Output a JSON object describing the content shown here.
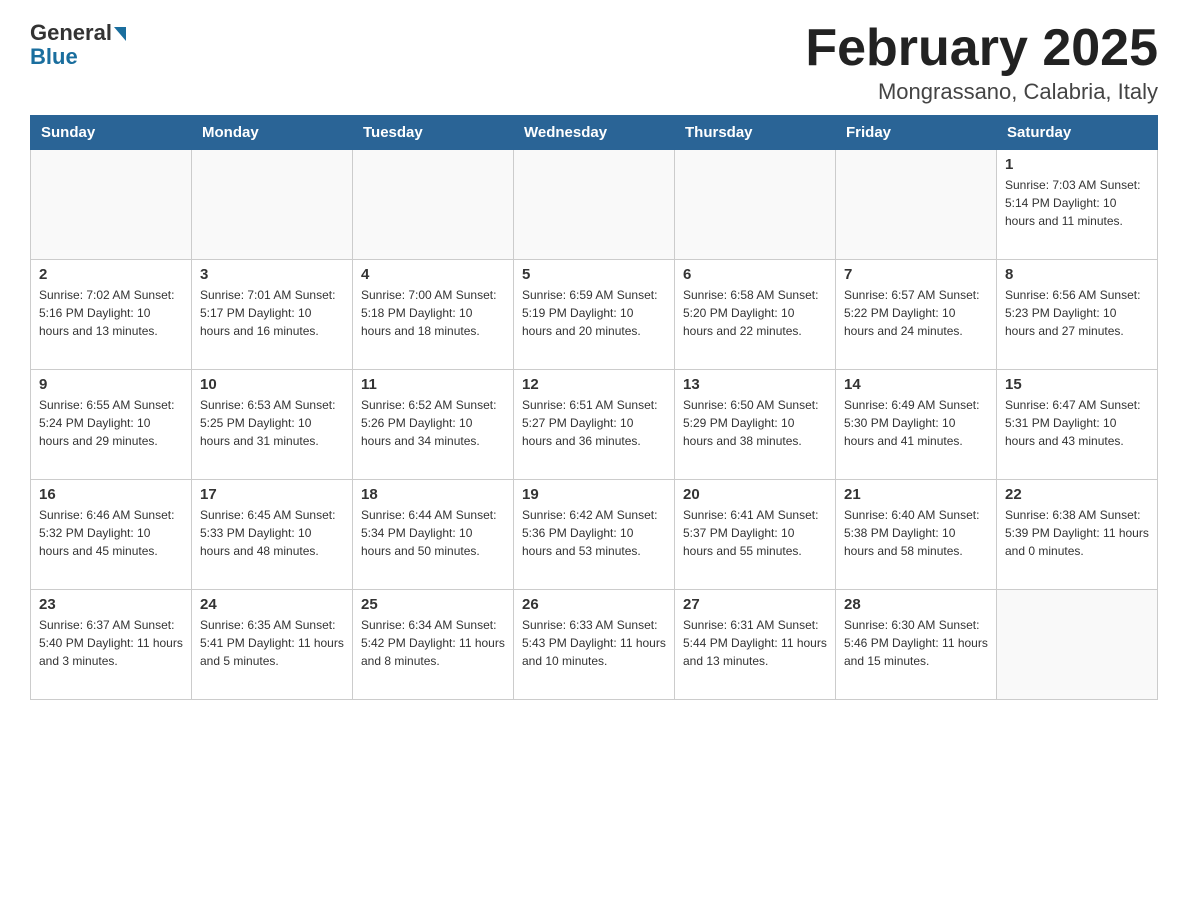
{
  "header": {
    "logo_general": "General",
    "logo_blue": "Blue",
    "month_title": "February 2025",
    "location": "Mongrassano, Calabria, Italy"
  },
  "weekdays": [
    "Sunday",
    "Monday",
    "Tuesday",
    "Wednesday",
    "Thursday",
    "Friday",
    "Saturday"
  ],
  "weeks": [
    [
      {
        "day": "",
        "info": ""
      },
      {
        "day": "",
        "info": ""
      },
      {
        "day": "",
        "info": ""
      },
      {
        "day": "",
        "info": ""
      },
      {
        "day": "",
        "info": ""
      },
      {
        "day": "",
        "info": ""
      },
      {
        "day": "1",
        "info": "Sunrise: 7:03 AM\nSunset: 5:14 PM\nDaylight: 10 hours and 11 minutes."
      }
    ],
    [
      {
        "day": "2",
        "info": "Sunrise: 7:02 AM\nSunset: 5:16 PM\nDaylight: 10 hours and 13 minutes."
      },
      {
        "day": "3",
        "info": "Sunrise: 7:01 AM\nSunset: 5:17 PM\nDaylight: 10 hours and 16 minutes."
      },
      {
        "day": "4",
        "info": "Sunrise: 7:00 AM\nSunset: 5:18 PM\nDaylight: 10 hours and 18 minutes."
      },
      {
        "day": "5",
        "info": "Sunrise: 6:59 AM\nSunset: 5:19 PM\nDaylight: 10 hours and 20 minutes."
      },
      {
        "day": "6",
        "info": "Sunrise: 6:58 AM\nSunset: 5:20 PM\nDaylight: 10 hours and 22 minutes."
      },
      {
        "day": "7",
        "info": "Sunrise: 6:57 AM\nSunset: 5:22 PM\nDaylight: 10 hours and 24 minutes."
      },
      {
        "day": "8",
        "info": "Sunrise: 6:56 AM\nSunset: 5:23 PM\nDaylight: 10 hours and 27 minutes."
      }
    ],
    [
      {
        "day": "9",
        "info": "Sunrise: 6:55 AM\nSunset: 5:24 PM\nDaylight: 10 hours and 29 minutes."
      },
      {
        "day": "10",
        "info": "Sunrise: 6:53 AM\nSunset: 5:25 PM\nDaylight: 10 hours and 31 minutes."
      },
      {
        "day": "11",
        "info": "Sunrise: 6:52 AM\nSunset: 5:26 PM\nDaylight: 10 hours and 34 minutes."
      },
      {
        "day": "12",
        "info": "Sunrise: 6:51 AM\nSunset: 5:27 PM\nDaylight: 10 hours and 36 minutes."
      },
      {
        "day": "13",
        "info": "Sunrise: 6:50 AM\nSunset: 5:29 PM\nDaylight: 10 hours and 38 minutes."
      },
      {
        "day": "14",
        "info": "Sunrise: 6:49 AM\nSunset: 5:30 PM\nDaylight: 10 hours and 41 minutes."
      },
      {
        "day": "15",
        "info": "Sunrise: 6:47 AM\nSunset: 5:31 PM\nDaylight: 10 hours and 43 minutes."
      }
    ],
    [
      {
        "day": "16",
        "info": "Sunrise: 6:46 AM\nSunset: 5:32 PM\nDaylight: 10 hours and 45 minutes."
      },
      {
        "day": "17",
        "info": "Sunrise: 6:45 AM\nSunset: 5:33 PM\nDaylight: 10 hours and 48 minutes."
      },
      {
        "day": "18",
        "info": "Sunrise: 6:44 AM\nSunset: 5:34 PM\nDaylight: 10 hours and 50 minutes."
      },
      {
        "day": "19",
        "info": "Sunrise: 6:42 AM\nSunset: 5:36 PM\nDaylight: 10 hours and 53 minutes."
      },
      {
        "day": "20",
        "info": "Sunrise: 6:41 AM\nSunset: 5:37 PM\nDaylight: 10 hours and 55 minutes."
      },
      {
        "day": "21",
        "info": "Sunrise: 6:40 AM\nSunset: 5:38 PM\nDaylight: 10 hours and 58 minutes."
      },
      {
        "day": "22",
        "info": "Sunrise: 6:38 AM\nSunset: 5:39 PM\nDaylight: 11 hours and 0 minutes."
      }
    ],
    [
      {
        "day": "23",
        "info": "Sunrise: 6:37 AM\nSunset: 5:40 PM\nDaylight: 11 hours and 3 minutes."
      },
      {
        "day": "24",
        "info": "Sunrise: 6:35 AM\nSunset: 5:41 PM\nDaylight: 11 hours and 5 minutes."
      },
      {
        "day": "25",
        "info": "Sunrise: 6:34 AM\nSunset: 5:42 PM\nDaylight: 11 hours and 8 minutes."
      },
      {
        "day": "26",
        "info": "Sunrise: 6:33 AM\nSunset: 5:43 PM\nDaylight: 11 hours and 10 minutes."
      },
      {
        "day": "27",
        "info": "Sunrise: 6:31 AM\nSunset: 5:44 PM\nDaylight: 11 hours and 13 minutes."
      },
      {
        "day": "28",
        "info": "Sunrise: 6:30 AM\nSunset: 5:46 PM\nDaylight: 11 hours and 15 minutes."
      },
      {
        "day": "",
        "info": ""
      }
    ]
  ]
}
